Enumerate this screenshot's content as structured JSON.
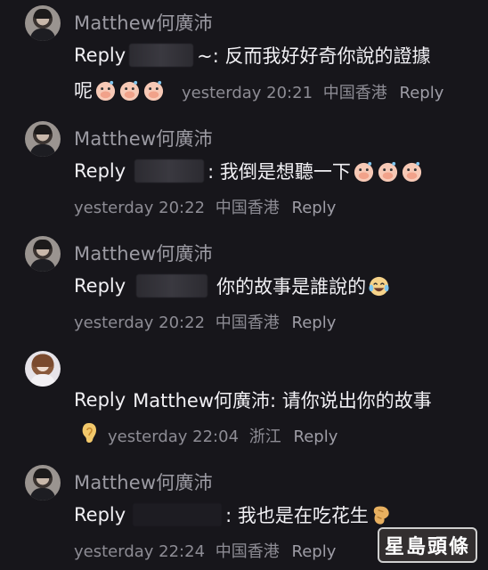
{
  "comments": [
    {
      "name": "Matthew何廣沛",
      "reply_word": "Reply",
      "text": "~: 反而我好好奇你說的證據",
      "text_line2": "呢",
      "time": "yesterday 20:21",
      "location": "中国香港",
      "reply_link": "Reply"
    },
    {
      "name": "Matthew何廣沛",
      "reply_word": "Reply",
      "text": ": 我倒是想聽一下",
      "time": "yesterday 20:22",
      "location": "中国香港",
      "reply_link": "Reply"
    },
    {
      "name": "Matthew何廣沛",
      "reply_word": "Reply",
      "text": "你的故事是誰說的",
      "time": "yesterday 20:22",
      "location": "中国香港",
      "reply_link": "Reply"
    },
    {
      "name": "",
      "reply_word": "Reply",
      "target": "Matthew何廣沛",
      "text": ": 请你说出你的故事",
      "time": "yesterday 22:04",
      "location": "浙江",
      "reply_link": "Reply"
    },
    {
      "name": "Matthew何廣沛",
      "reply_word": "Reply",
      "text": ": 我也是在吃花生",
      "time": "yesterday 22:24",
      "location": "中国香港",
      "reply_link": "Reply"
    }
  ],
  "watermark": "星島頭條",
  "icons": {
    "emoji_laugh": "laugh-cover-mouth-icon",
    "emoji_cry_laugh": "laughing-tears-icon",
    "emoji_ear": "ear-icon",
    "emoji_peanut": "peanut-icon"
  }
}
